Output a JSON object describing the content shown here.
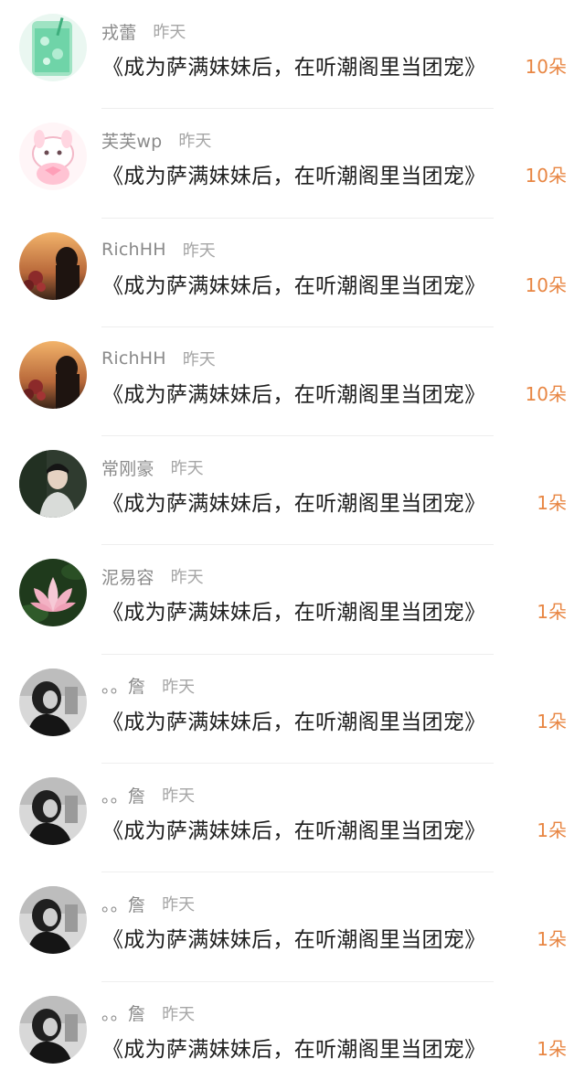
{
  "items": [
    {
      "name": "戎蕾",
      "time": "昨天",
      "title": "《成为萨满妹妹后，在听潮阁里当团宠》",
      "amount": "10朵",
      "avatar": "glass-drink-avatar"
    },
    {
      "name": "芙芙wp",
      "time": "昨天",
      "title": "《成为萨满妹妹后，在听潮阁里当团宠》",
      "amount": "10朵",
      "avatar": "pink-bunny-avatar"
    },
    {
      "name": "RichHH",
      "time": "昨天",
      "title": "《成为萨满妹妹后，在听潮阁里当团宠》",
      "amount": "10朵",
      "avatar": "sunset-girl-avatar"
    },
    {
      "name": "RichHH",
      "time": "昨天",
      "title": "《成为萨满妹妹后，在听潮阁里当团宠》",
      "amount": "10朵",
      "avatar": "sunset-girl-avatar"
    },
    {
      "name": "常刚豪",
      "time": "昨天",
      "title": "《成为萨满妹妹后，在听潮阁里当团宠》",
      "amount": "1朵",
      "avatar": "man-portrait-avatar"
    },
    {
      "name": "泥易容",
      "time": "昨天",
      "title": "《成为萨满妹妹后，在听潮阁里当团宠》",
      "amount": "1朵",
      "avatar": "lotus-avatar"
    },
    {
      "name": "。。詹",
      "time": "昨天",
      "title": "《成为萨满妹妹后，在听潮阁里当团宠》",
      "amount": "1朵",
      "avatar": "bw-girl-avatar"
    },
    {
      "name": "。。詹",
      "time": "昨天",
      "title": "《成为萨满妹妹后，在听潮阁里当团宠》",
      "amount": "1朵",
      "avatar": "bw-girl-avatar"
    },
    {
      "name": "。。詹",
      "time": "昨天",
      "title": "《成为萨满妹妹后，在听潮阁里当团宠》",
      "amount": "1朵",
      "avatar": "bw-girl-avatar"
    },
    {
      "name": "。。詹",
      "time": "昨天",
      "title": "《成为萨满妹妹后，在听潮阁里当团宠》",
      "amount": "1朵",
      "avatar": "bw-girl-avatar"
    }
  ],
  "colors": {
    "amount": "#e88643",
    "name": "#8a8a8a",
    "time": "#a6a6a6",
    "title": "#1e1e1e"
  }
}
